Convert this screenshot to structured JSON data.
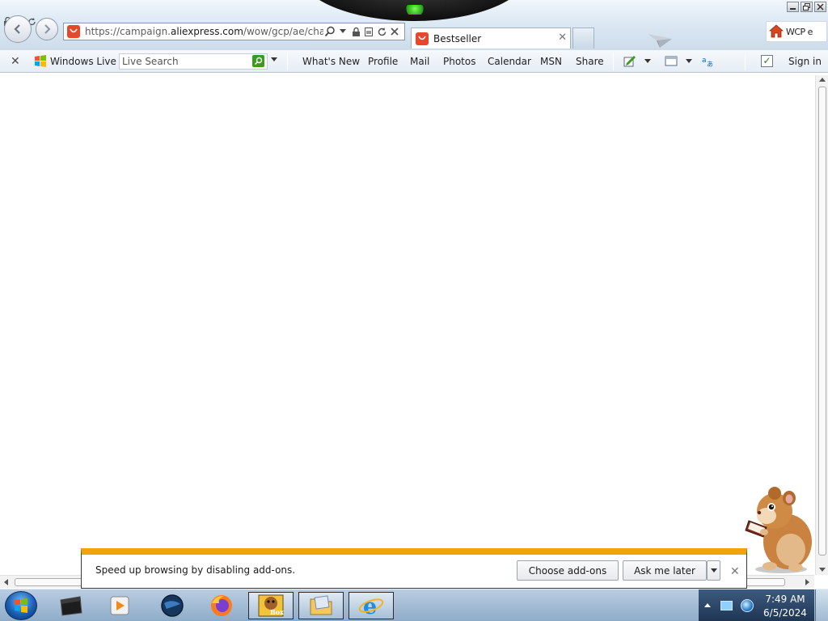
{
  "browser": {
    "address": {
      "url_prefix": "https://campaign.",
      "url_domain": "aliexpress.com",
      "url_path": "/wow/gcp/ae/channel/"
    },
    "tab": {
      "title": "Bestseller"
    },
    "home_button_text": "WCP e"
  },
  "live_toolbar": {
    "brand": "Windows Live",
    "search_placeholder": "Live Search",
    "links": [
      "What's New",
      "Profile",
      "Mail",
      "Photos",
      "Calendar",
      "MSN",
      "Share"
    ],
    "sign_in": "Sign in"
  },
  "notification": {
    "message": "Speed up browsing by disabling add-ons.",
    "choose_label": "Choose add-ons",
    "later_label": "Ask me later"
  },
  "taskbar": {
    "time": "7:49 AM",
    "date": "6/5/2024",
    "box_label": "Box"
  },
  "colors": {
    "notify_accent": "#f0a30a",
    "aliexpress_red": "#e8472b",
    "live_search_green": "#3c9b1f"
  }
}
